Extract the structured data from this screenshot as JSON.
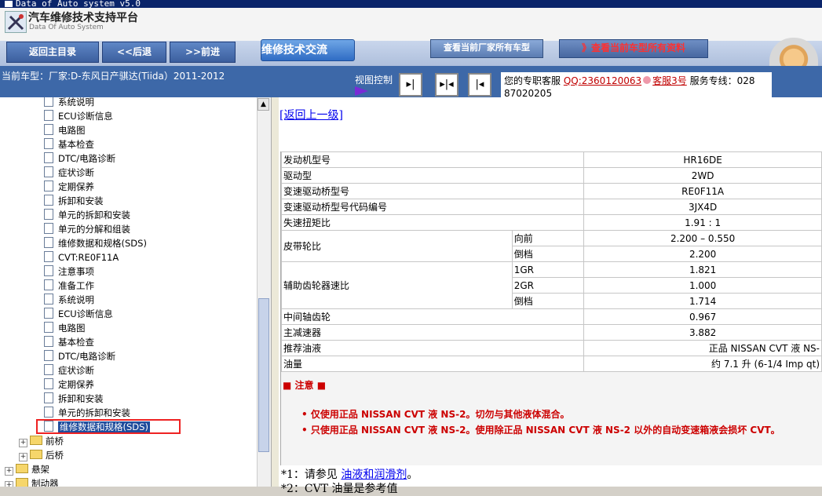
{
  "window": {
    "title": "Data of Auto system v5.0"
  },
  "app": {
    "title": "汽车维修技术支持平台",
    "subtitle": "Data Of Auto System"
  },
  "nav": {
    "home": "返回主目录",
    "back": "<<后退",
    "forward": ">>前进",
    "forum": "维修技术交流",
    "all_models": "查看当前厂家所有车型",
    "all_docs": "》查看当前车型所有资料"
  },
  "info": {
    "vehicle": "当前车型：厂家:D-东风日产骐达(Tiida）2011-2012",
    "view_control": "视图控制",
    "support_prefix": "您的专职客服",
    "qq": "QQ:2360120063",
    "agent": "客服3号",
    "hotline_label": "服务专线：",
    "hotline_number": "028",
    "hotline_tail": "87020205"
  },
  "tree": {
    "items": [
      {
        "label": "系统说明"
      },
      {
        "label": "ECU诊断信息"
      },
      {
        "label": "电路图"
      },
      {
        "label": "基本检查"
      },
      {
        "label": "DTC/电路诊断"
      },
      {
        "label": "症状诊断"
      },
      {
        "label": "定期保养"
      },
      {
        "label": "拆卸和安装"
      },
      {
        "label": "单元的拆卸和安装"
      },
      {
        "label": "单元的分解和组装"
      },
      {
        "label": "维修数据和规格(SDS)"
      },
      {
        "label": "CVT:RE0F11A"
      },
      {
        "label": "注意事项"
      },
      {
        "label": "准备工作"
      },
      {
        "label": "系统说明"
      },
      {
        "label": "ECU诊断信息"
      },
      {
        "label": "电路图"
      },
      {
        "label": "基本检查"
      },
      {
        "label": "DTC/电路诊断"
      },
      {
        "label": "症状诊断"
      },
      {
        "label": "定期保养"
      },
      {
        "label": "拆卸和安装"
      },
      {
        "label": "单元的拆卸和安装"
      },
      {
        "label": "维修数据和规格(SDS)"
      }
    ],
    "folders": [
      {
        "label": "前桥"
      },
      {
        "label": "后桥"
      },
      {
        "label": "悬架"
      },
      {
        "label": "制动器"
      }
    ]
  },
  "content": {
    "back_link": "[返回上一级]",
    "rows": {
      "engine_model": {
        "label": "发动机型号",
        "value": "HR16DE"
      },
      "drive": {
        "label": "驱动型",
        "value": "2WD"
      },
      "transaxle": {
        "label": "变速驱动桥型号",
        "value": "RE0F11A"
      },
      "transaxle_code": {
        "label": "变速驱动桥型号代码编号",
        "value": "3JX4D"
      },
      "stall_torque": {
        "label": "失速扭矩比",
        "value": "1.91 : 1"
      },
      "belt_ratio": {
        "label": "皮带轮比",
        "forward_label": "向前",
        "forward_value": "2.200 – 0.550",
        "reverse_label": "倒档",
        "reverse_value": "2.200"
      },
      "aux_ratio": {
        "label": "辅助齿轮器速比",
        "g1_label": "1GR",
        "g1_value": "1.821",
        "g2_label": "2GR",
        "g2_value": "1.000",
        "rev_label": "倒档",
        "rev_value": "1.714"
      },
      "counter": {
        "label": "中间轴齿轮",
        "value": "0.967"
      },
      "final": {
        "label": "主减速器",
        "value": "3.882"
      },
      "fluid": {
        "label": "推荐油液",
        "value": "正品 NISSAN CVT 液 NS-"
      },
      "capacity": {
        "label": "油量",
        "value": "约 7.1 升 (6-1/4 Imp qt)"
      }
    },
    "caution_title": "■ 注意 ■",
    "notes": [
      "• 仅使用正品 NISSAN CVT 液 NS-2。切勿与其他液体混合。",
      "• 只使用正品 NISSAN CVT 液 NS-2。使用除正品 NISSAN CVT 液 NS-2 以外的自动变速箱液会损坏 CVT。"
    ],
    "footnote1_prefix": "*1：请参见 ",
    "footnote1_link": "油液和润滑剂",
    "footnote1_suffix": "。",
    "footnote2": "*2：CVT 油量是参考值"
  }
}
